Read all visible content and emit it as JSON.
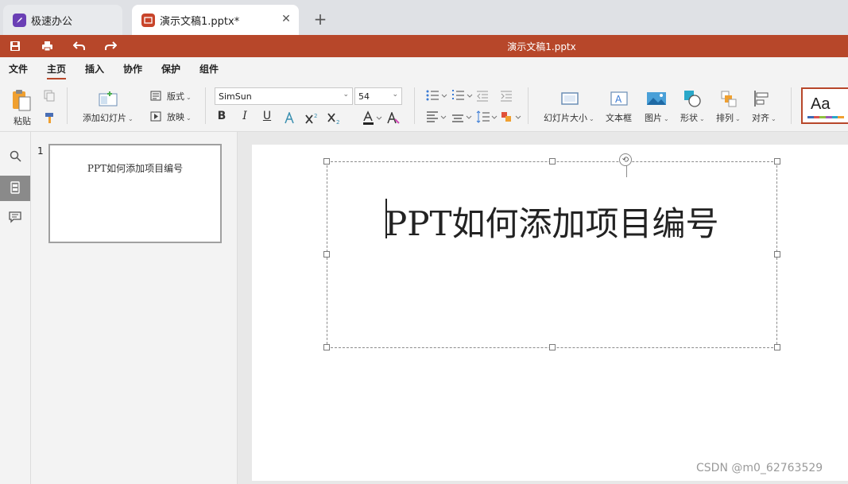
{
  "tabs": {
    "home_label": "极速办公",
    "doc_label": "演示文稿1.pptx*",
    "close_symbol": "✕",
    "new_tab_symbol": "+"
  },
  "titlebar": {
    "document_title": "演示文稿1.pptx",
    "icons": [
      "save-icon",
      "print-icon",
      "undo-icon",
      "redo-icon"
    ]
  },
  "menu": {
    "items": [
      "文件",
      "主页",
      "插入",
      "协作",
      "保护",
      "组件"
    ],
    "active": "主页"
  },
  "ribbon": {
    "paste_label": "粘贴",
    "add_slide_label": "添加幻灯片",
    "layout_label": "版式",
    "play_label": "放映",
    "font_name": "SimSun",
    "font_size": "54",
    "slide_size_label": "幻灯片大小",
    "textbox_label": "文本框",
    "picture_label": "图片",
    "shape_label": "形状",
    "arrange_label": "排列",
    "align_label": "对齐",
    "theme_preview": "Aa",
    "format_buttons": [
      "B",
      "I",
      "U"
    ],
    "colors": {
      "accent": "#b7472a",
      "theme_bar": [
        "#3b6bb5",
        "#d9534f",
        "#8fbf3f",
        "#9b59b6",
        "#2aa8c9",
        "#f0a030"
      ]
    }
  },
  "thumbnails": [
    {
      "number": "1",
      "title": "PPT如何添加项目编号"
    }
  ],
  "slide": {
    "title": "PPT如何添加项目编号"
  },
  "watermark": "CSDN @m0_62763529"
}
